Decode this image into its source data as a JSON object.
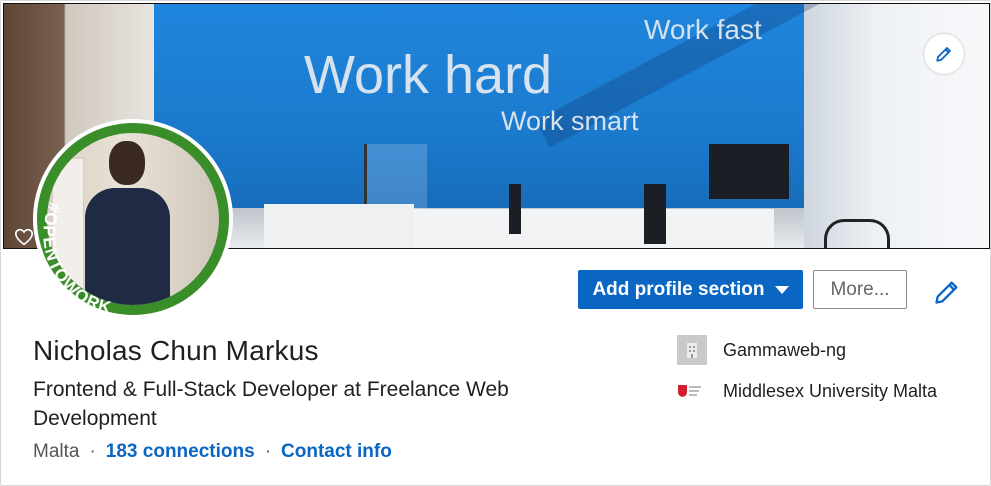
{
  "banner": {
    "wall_text": [
      "Work fast",
      "Work hard",
      "Work smart"
    ],
    "edit_icon": "pencil-icon",
    "heart_icon": "heart-icon"
  },
  "avatar": {
    "frame_text": "#OPENTOWORK",
    "frame_color": "#3a8e2a"
  },
  "actions": {
    "add_section_label": "Add profile section",
    "more_label": "More...",
    "edit_icon": "pencil-icon"
  },
  "profile": {
    "name": "Nicholas Chun Markus",
    "headline": "Frontend & Full-Stack Developer at Freelance Web Development",
    "location": "Malta",
    "connections": "183 connections",
    "contact": "Contact info"
  },
  "experience": {
    "company": "Gammaweb-ng",
    "school": "Middlesex University Malta"
  },
  "colors": {
    "accent": "#0a66c2",
    "open_to_work": "#3a8e2a"
  }
}
